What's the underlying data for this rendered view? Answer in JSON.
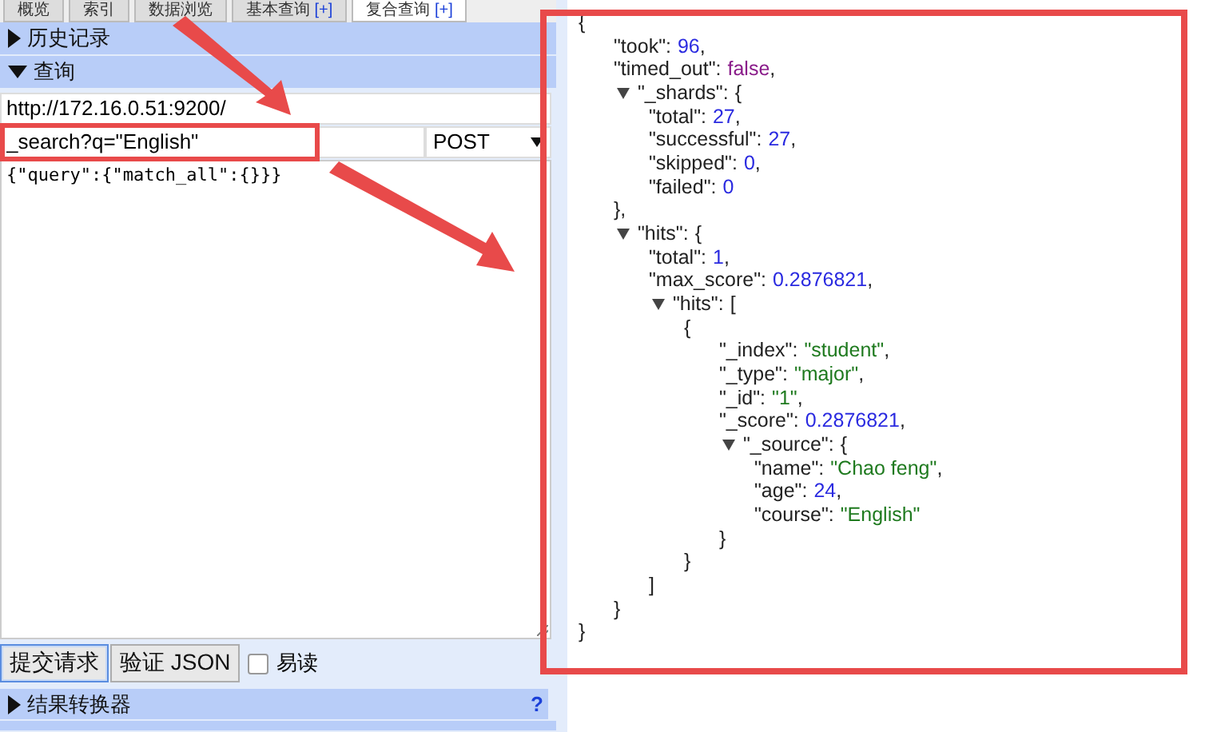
{
  "tabs": [
    {
      "label": "概览",
      "selected": false
    },
    {
      "label": "索引",
      "selected": false
    },
    {
      "label": "数据浏览",
      "selected": false
    },
    {
      "label": "基本查询",
      "plus": "[+]",
      "selected": false
    },
    {
      "label": "复合查询",
      "plus": "[+]",
      "selected": true
    }
  ],
  "sections": [
    {
      "title": "历史记录",
      "expanded": false
    },
    {
      "title": "查询",
      "expanded": true
    }
  ],
  "query": {
    "url": "http://172.16.0.51:9200/",
    "path": "_search?q=\"English\"",
    "method": "POST",
    "body": "{\"query\":{\"match_all\":{}}}"
  },
  "buttons": [
    {
      "label": "提交请求",
      "focused": true
    },
    {
      "label": "验证 JSON",
      "focused": false
    }
  ],
  "pretty_option": {
    "label": "易读",
    "checked": false
  },
  "result_transformer": {
    "title": "结果转换器",
    "expanded": false,
    "help": "?"
  },
  "response": {
    "open": "{",
    "close": "}",
    "children": [
      {
        "key": "\"took\":",
        "value": "96",
        "kind": "number",
        "comma": ","
      },
      {
        "key": "\"timed_out\":",
        "value": "false",
        "kind": "boolean",
        "comma": ","
      },
      {
        "key": "\"_shards\":",
        "open": "{",
        "expanded": true,
        "close": "},",
        "children": [
          {
            "key": "\"total\":",
            "value": "27",
            "kind": "number",
            "comma": ","
          },
          {
            "key": "\"successful\":",
            "value": "27",
            "kind": "number",
            "comma": ","
          },
          {
            "key": "\"skipped\":",
            "value": "0",
            "kind": "number",
            "comma": ","
          },
          {
            "key": "\"failed\":",
            "value": "0",
            "kind": "number"
          }
        ]
      },
      {
        "key": "\"hits\":",
        "open": "{",
        "expanded": true,
        "close": "}",
        "children": [
          {
            "key": "\"total\":",
            "value": "1",
            "kind": "number",
            "comma": ","
          },
          {
            "key": "\"max_score\":",
            "value": "0.2876821",
            "kind": "number",
            "comma": ","
          },
          {
            "key": "\"hits\":",
            "open": "[",
            "expanded": true,
            "close": "]",
            "children": [
              {
                "open": "{",
                "close": "}",
                "children": [
                  {
                    "key": "\"_index\":",
                    "value": "\"student\"",
                    "kind": "string",
                    "comma": ","
                  },
                  {
                    "key": "\"_type\":",
                    "value": "\"major\"",
                    "kind": "string",
                    "comma": ","
                  },
                  {
                    "key": "\"_id\":",
                    "value": "\"1\"",
                    "kind": "string",
                    "comma": ","
                  },
                  {
                    "key": "\"_score\":",
                    "value": "0.2876821",
                    "kind": "number",
                    "comma": ","
                  },
                  {
                    "key": "\"_source\":",
                    "open": "{",
                    "expanded": true,
                    "close": "}",
                    "children": [
                      {
                        "key": "\"name\":",
                        "value": "\"Chao feng\"",
                        "kind": "string",
                        "comma": ","
                      },
                      {
                        "key": "\"age\":",
                        "value": "24",
                        "kind": "number",
                        "comma": ","
                      },
                      {
                        "key": "\"course\":",
                        "value": "\"English\"",
                        "kind": "string"
                      }
                    ]
                  }
                ]
              }
            ]
          }
        ]
      }
    ]
  }
}
